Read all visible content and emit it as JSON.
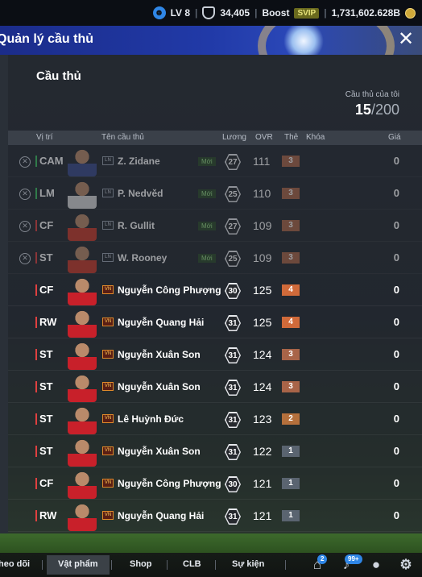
{
  "topbar": {
    "level": "LV 8",
    "currency1": "34,405",
    "boost_label": "Boost",
    "svip_label": "SVIP",
    "currency2": "1,731,602.628B"
  },
  "banner": {
    "title": "Quản lý cầu thủ"
  },
  "section": {
    "title": "Cầu thủ",
    "capacity_label": "Cầu thủ của tôi",
    "capacity_current": "15",
    "capacity_max": "/200"
  },
  "table": {
    "headers": {
      "position": "Vị trí",
      "name": "Tên cầu thủ",
      "wage": "Lương",
      "ovr": "OVR",
      "level": "Thẻ",
      "lock": "Khóa",
      "price": "Giá"
    },
    "rows": [
      {
        "pos": "CAM",
        "name": "Z. Zidane",
        "badge": "Mới",
        "wage": "27",
        "ovr": "111",
        "level": "3",
        "price": "0",
        "dim": true,
        "season": "LN",
        "kit": "#3a4a8a"
      },
      {
        "pos": "LM",
        "name": "P. Nedvěd",
        "badge": "Mới",
        "wage": "25",
        "ovr": "110",
        "level": "3",
        "price": "0",
        "dim": true,
        "season": "LN",
        "kit": "#d8d8d8"
      },
      {
        "pos": "CF",
        "name": "R. Gullit",
        "badge": "Mới",
        "wage": "27",
        "ovr": "109",
        "level": "3",
        "price": "0",
        "dim": true,
        "season": "LN",
        "kit": "#c83a2a"
      },
      {
        "pos": "ST",
        "name": "W. Rooney",
        "badge": "Mới",
        "wage": "25",
        "ovr": "109",
        "level": "3",
        "price": "0",
        "dim": true,
        "season": "LN",
        "kit": "#c83a2a"
      },
      {
        "pos": "CF",
        "name": "Nguyễn Công Phượng",
        "badge": "",
        "wage": "30",
        "ovr": "125",
        "level": "4",
        "price": "0",
        "dim": false,
        "season": "VN",
        "kit": "#c8202a"
      },
      {
        "pos": "RW",
        "name": "Nguyễn Quang Hải",
        "badge": "",
        "wage": "31",
        "ovr": "125",
        "level": "4",
        "price": "0",
        "dim": false,
        "season": "VN",
        "kit": "#c8202a"
      },
      {
        "pos": "ST",
        "name": "Nguyễn Xuân Son",
        "badge": "",
        "wage": "31",
        "ovr": "124",
        "level": "3",
        "price": "0",
        "dim": false,
        "season": "VN",
        "kit": "#c8202a"
      },
      {
        "pos": "ST",
        "name": "Nguyễn Xuân Son",
        "badge": "",
        "wage": "31",
        "ovr": "124",
        "level": "3",
        "price": "0",
        "dim": false,
        "season": "VN",
        "kit": "#c8202a"
      },
      {
        "pos": "ST",
        "name": "Lê Huỳnh Đức",
        "badge": "",
        "wage": "31",
        "ovr": "123",
        "level": "2",
        "price": "0",
        "dim": false,
        "season": "VN",
        "kit": "#c8202a"
      },
      {
        "pos": "ST",
        "name": "Nguyễn Xuân Son",
        "badge": "",
        "wage": "31",
        "ovr": "122",
        "level": "1",
        "price": "0",
        "dim": false,
        "season": "VN",
        "kit": "#c8202a"
      },
      {
        "pos": "CF",
        "name": "Nguyễn Công Phượng",
        "badge": "",
        "wage": "30",
        "ovr": "121",
        "level": "1",
        "price": "0",
        "dim": false,
        "season": "VN",
        "kit": "#c8202a"
      },
      {
        "pos": "RW",
        "name": "Nguyễn Quang Hải",
        "badge": "",
        "wage": "31",
        "ovr": "121",
        "level": "1",
        "price": "0",
        "dim": false,
        "season": "VN",
        "kit": "#c8202a"
      }
    ]
  },
  "bottom_nav": {
    "tabs": [
      "heo dõi",
      "Vật phẩm",
      "Shop",
      "CLB",
      "Sự kiện"
    ],
    "active_tab": "Vật phẩm",
    "home_badge": "2",
    "bell_badge": "99+"
  },
  "colors": {
    "level_4": "#d06a3a",
    "level_3": "#a86448",
    "level_2": "#b5703c",
    "level_1": "#5a6470",
    "pos_attack": "#e04040",
    "pos_mid": "#3cc060"
  }
}
